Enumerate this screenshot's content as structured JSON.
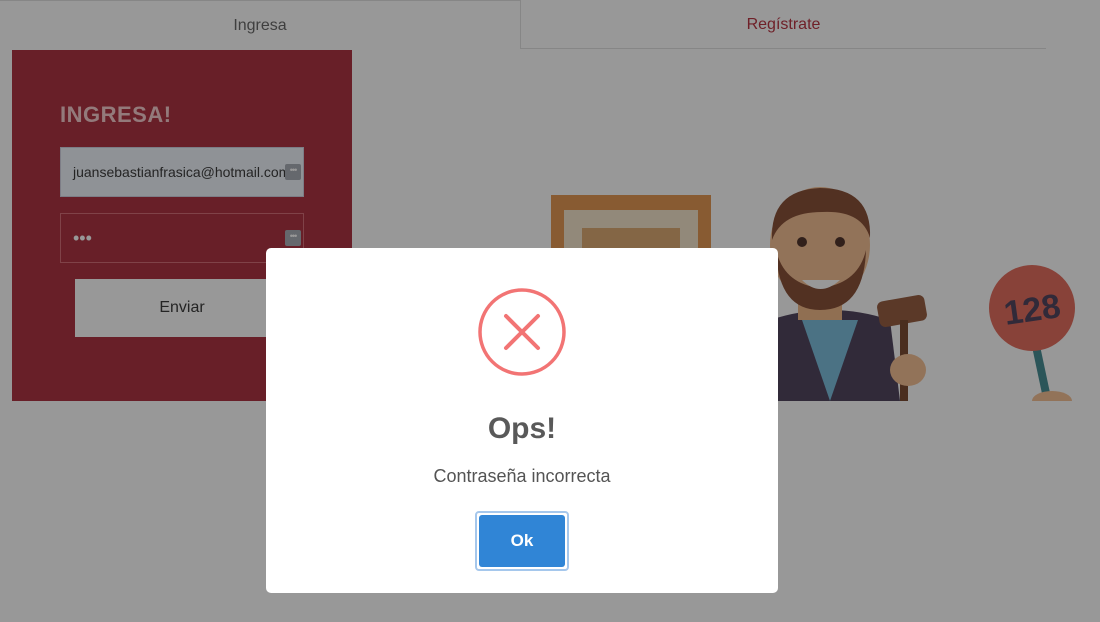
{
  "tabs": {
    "login": "Ingresa",
    "register": "Regístrate"
  },
  "login": {
    "title": "INGRESA!",
    "email_value": "juansebastianfrasica@hotmail.com",
    "password_mask": "•••",
    "submit_label": "Enviar"
  },
  "illustration": {
    "paddle_number": "128"
  },
  "modal": {
    "title": "Ops!",
    "message": "Contraseña incorrecta",
    "ok_label": "Ok",
    "icon": "error-x-icon",
    "icon_color": "#f27474",
    "button_color": "#3085d6"
  },
  "colors": {
    "brand_red": "#a3172a",
    "tab_active_text": "#b0192a"
  }
}
